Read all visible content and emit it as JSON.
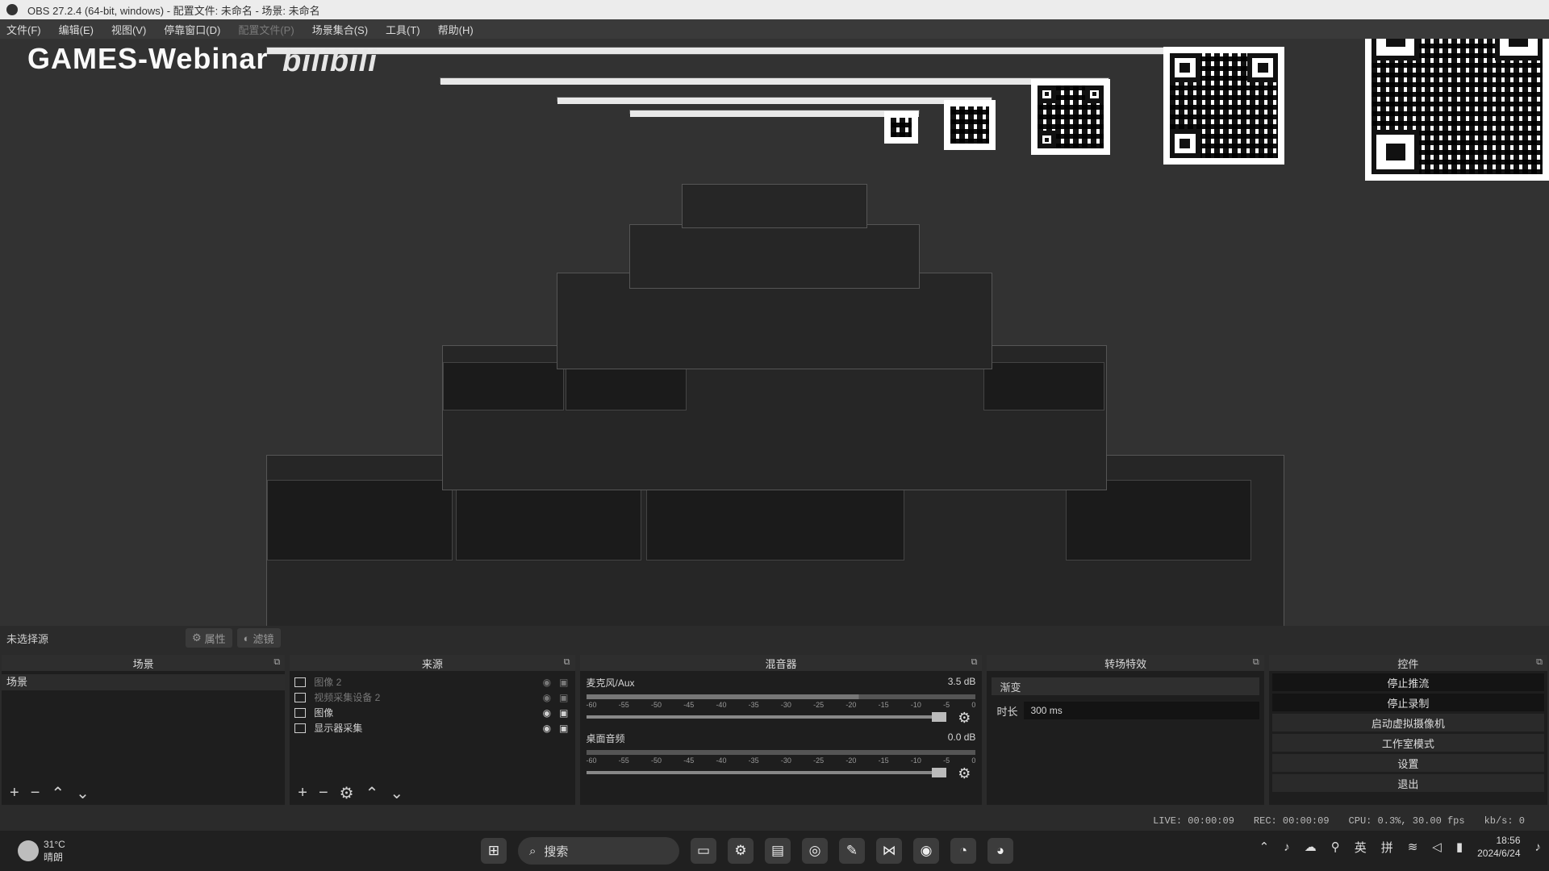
{
  "window": {
    "title": "OBS 27.2.4 (64-bit, windows) - 配置文件: 未命名 - 场景: 未命名"
  },
  "menu": [
    {
      "label": "文件(F)",
      "disabled": false
    },
    {
      "label": "编辑(E)",
      "disabled": false
    },
    {
      "label": "视图(V)",
      "disabled": false
    },
    {
      "label": "停靠窗口(D)",
      "disabled": false
    },
    {
      "label": "配置文件(P)",
      "disabled": true
    },
    {
      "label": "场景集合(S)",
      "disabled": false
    },
    {
      "label": "工具(T)",
      "disabled": false
    },
    {
      "label": "帮助(H)",
      "disabled": false
    }
  ],
  "overlay": {
    "title": "GAMES-Webinar",
    "brand": "bilibili"
  },
  "scene_bar": {
    "label": "未选择源",
    "properties": "属性",
    "filters": "滤镜"
  },
  "scenes": {
    "header": "场景",
    "items": [
      "场景"
    ]
  },
  "sources": {
    "header": "来源",
    "items": [
      {
        "name": "图像 2",
        "dim": true
      },
      {
        "name": "视频采集设备 2",
        "dim": true
      },
      {
        "name": "图像",
        "dim": false
      },
      {
        "name": "显示器采集",
        "dim": false
      }
    ]
  },
  "mixer": {
    "header": "混音器",
    "tracks": [
      {
        "name": "麦克风/Aux",
        "db": "3.5 dB",
        "level": 0.72
      },
      {
        "name": "桌面音频",
        "db": "0.0 dB",
        "level": 0.0
      }
    ],
    "ticks": [
      "-60",
      "-55",
      "-50",
      "-45",
      "-40",
      "-35",
      "-30",
      "-25",
      "-20",
      "-15",
      "-10",
      "-5",
      "0"
    ]
  },
  "transitions": {
    "header": "转场特效",
    "selected": "渐变",
    "duration_label": "时长",
    "duration_value": "300 ms"
  },
  "controls": {
    "header": "控件",
    "buttons": [
      "停止推流",
      "停止录制",
      "启动虚拟摄像机",
      "工作室模式",
      "设置",
      "退出"
    ]
  },
  "status": {
    "live": "LIVE: 00:00:09",
    "rec": "REC: 00:00:09",
    "cpu": "CPU: 0.3%, 30.00 fps",
    "kb": "kb/s: 0"
  },
  "taskbar": {
    "weather_temp": "31°C",
    "weather_desc": "晴朗",
    "search": "搜索",
    "ime_lang": "英",
    "ime_mode": "拼",
    "time": "18:56",
    "date": "2024/6/24"
  }
}
